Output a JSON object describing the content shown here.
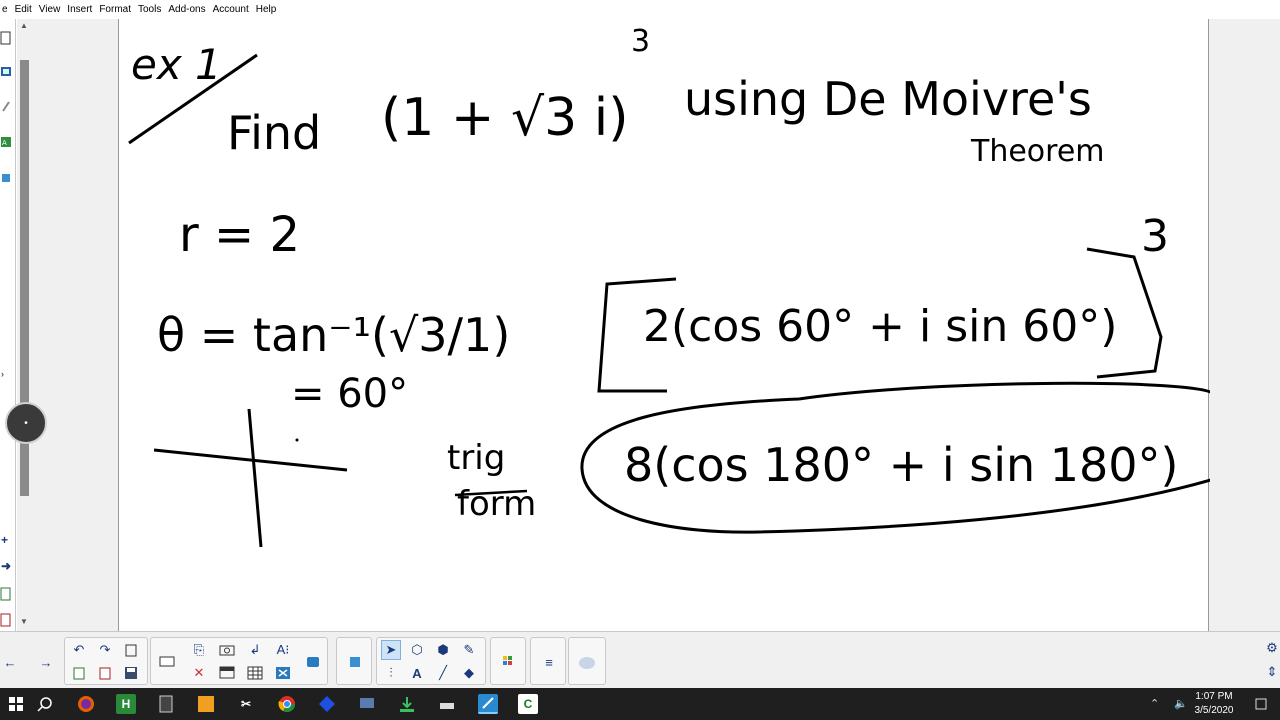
{
  "menu": {
    "items": [
      "e",
      "Edit",
      "View",
      "Insert",
      "Format",
      "Tools",
      "Add-ons",
      "Account",
      "Help"
    ]
  },
  "handwriting": {
    "example_label": "ex 1",
    "problem_find": "Find",
    "problem_expr": "(1 + √3 i)",
    "problem_exp": "3",
    "problem_using": "using De Moivre's",
    "problem_theorem": "Theorem",
    "r_line": "r = 2",
    "theta_line": "θ = tan⁻¹(√3/1)",
    "theta_value": "= 60°",
    "trig_label": "trig",
    "form_label": "form",
    "box_expr": "2(cos 60° + i sin 60°)",
    "box_exp": "3",
    "answer_expr": "8(cos 180° + i sin 180°)"
  },
  "toolbar": {
    "icons": [
      "back-arrow-icon",
      "forward-arrow-icon",
      "undo-icon",
      "redo-icon",
      "paste-icon",
      "copy-icon",
      "save-icon",
      "delete-icon",
      "screen-shade-icon",
      "camera-icon",
      "table-icon",
      "text-recognition-icon",
      "fill-icon",
      "select-arrow-icon",
      "shapes-icon",
      "pen-icon",
      "eraser-icon",
      "text-icon",
      "line-icon",
      "highlighter-icon",
      "grid-icon",
      "measure-icon",
      "page-icon"
    ]
  },
  "taskbar": {
    "time": "1:07 PM",
    "date": "3/5/2020"
  },
  "colors": {
    "ink": "#000000",
    "taskbar": "#1f1f1f",
    "toolbar_bg": "#f0f0f0",
    "accent": "#1a3a7a"
  }
}
